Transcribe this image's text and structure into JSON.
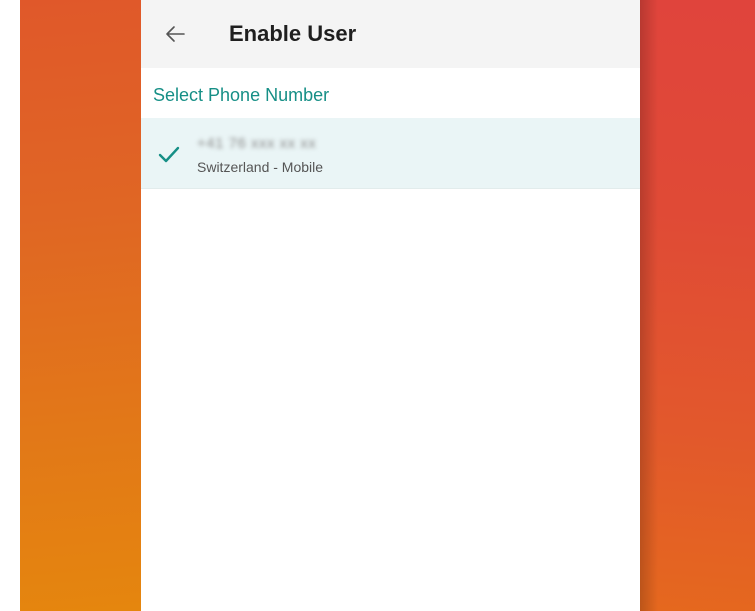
{
  "header": {
    "title": "Enable User",
    "back_icon": "arrow-left-icon"
  },
  "section": {
    "label": "Select Phone Number"
  },
  "phone_numbers": [
    {
      "number": "+41 76 xxx xx xx",
      "type": "Switzerland - Mobile",
      "selected": true,
      "icon": "check-icon"
    }
  ],
  "colors": {
    "accent": "#168f86",
    "app_bar": "#f4f4f4",
    "selected_row": "#eaf5f6"
  }
}
